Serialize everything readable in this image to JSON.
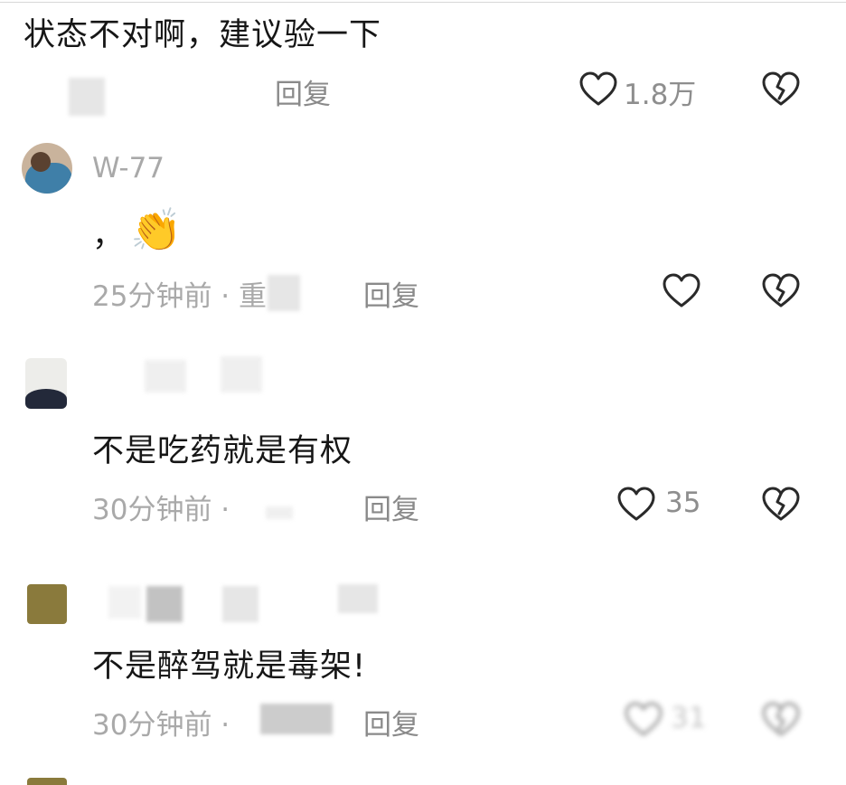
{
  "comments": [
    {
      "text": "状态不对啊，建议验一下",
      "reply_label": "回复",
      "like_count": "1.8万"
    },
    {
      "username": "W-77",
      "text": "，",
      "emoji": "👏",
      "time": "25分钟前 · 重",
      "reply_label": "回复",
      "like_count": ""
    },
    {
      "text": "不是吃药就是有权",
      "time": "30分钟前 ·",
      "reply_label": "回复",
      "like_count": "35"
    },
    {
      "text": "不是醉驾就是毒架!",
      "time": "30分钟前 ·",
      "reply_label": "回复",
      "like_count": "31"
    }
  ],
  "icons": {
    "like": "heart-outline-icon",
    "dislike": "broken-heart-icon"
  }
}
